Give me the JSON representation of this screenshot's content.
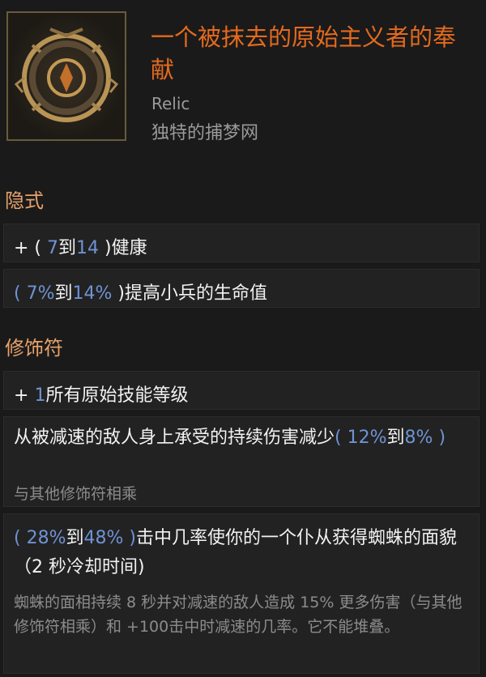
{
  "item": {
    "title": "一个被抹去的原始主义者的奉献",
    "type": "Relic",
    "subtype": "独特的捕梦网"
  },
  "implicit": {
    "heading": "隐式",
    "rows": [
      {
        "prefix": "+ (",
        "a": " 7",
        "mid": "到",
        "b": "14 ",
        "suffix": ")健康"
      },
      {
        "prefix": "(",
        "a": " 7%",
        "mid": "到",
        "b": "14% ",
        "suffix": ")提高小兵的生命值"
      }
    ]
  },
  "modifiers": {
    "heading": "修饰符",
    "row1": {
      "prefix": "+ ",
      "a": "1",
      "text": "所有原始技能等级"
    },
    "row2": {
      "text": "从被减速的敌人身上承受的持续伤害减少",
      "open": "(",
      "a": " 12%",
      "mid": "到",
      "b": "8% ",
      "close": ")",
      "note": "与其他修饰符相乘"
    },
    "row3": {
      "open": "(",
      "a": " 28%",
      "mid": "到",
      "b": "48% ",
      "close": ")",
      "text": "击中几率使你的一个仆从获得蜘蛛的面貌（2 秒冷却时间)",
      "note": "蜘蛛的面相持续 8 秒并对减速的敌人造成 15% 更多伤害（与其他修饰符相乘）和 +100击中时减速的几率。它不能堆叠。"
    }
  },
  "colors": {
    "title": "#e46a1e",
    "section": "#e8a26b",
    "value": "#6f93d3",
    "muted": "#8c8c8c"
  },
  "icon": "dreamcatcher-icon"
}
